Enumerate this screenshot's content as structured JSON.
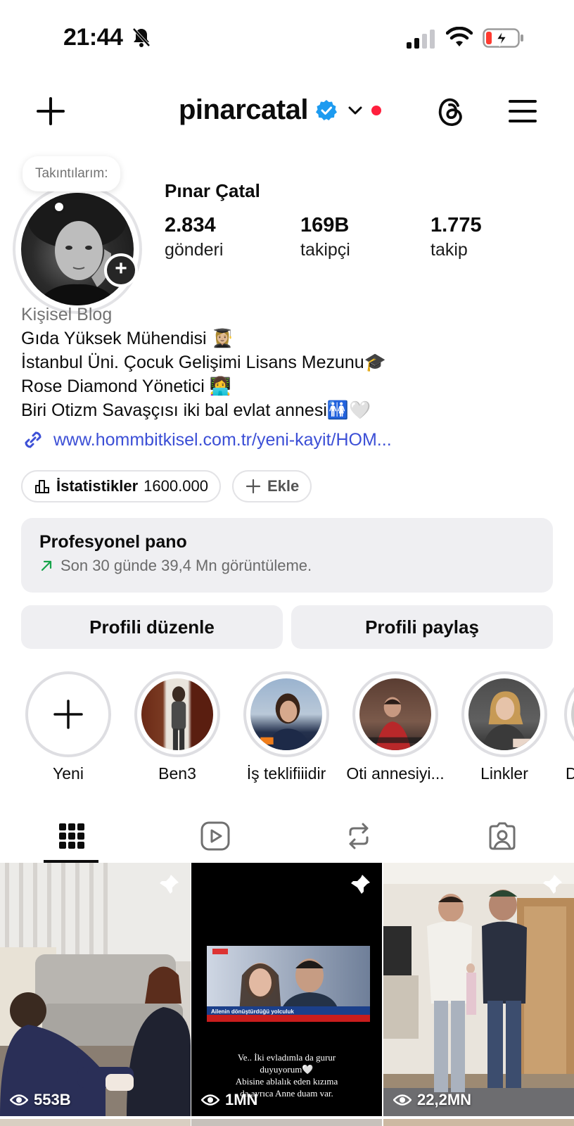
{
  "status_bar": {
    "time": "21:44"
  },
  "header": {
    "username": "pinarcatal"
  },
  "profile": {
    "note": "Takıntılarım:",
    "full_name": "Pınar Çatal",
    "stats": [
      {
        "value": "2.834",
        "label": "gönderi"
      },
      {
        "value": "169B",
        "label": "takipçi"
      },
      {
        "value": "1.775",
        "label": "takip"
      }
    ],
    "category": "Kişisel Blog",
    "bio_lines": [
      "Gıda Yüksek Mühendisi 👩🏼‍🎓",
      "İstanbul Üni. Çocuk Gelişimi Lisans Mezunu🎓",
      "Rose Diamond Yönetici 👩‍💻",
      "Biri Otizm Savaşçısı iki bal evlat annesi🚻🤍"
    ],
    "link": "www.hommbitkisel.com.tr/yeni-kayit/HOM..."
  },
  "pills": {
    "stats_label": "İstatistikler",
    "stats_value": "1600.000",
    "add_label": "Ekle"
  },
  "pro_panel": {
    "title": "Profesyonel pano",
    "subtitle": "Son 30 günde 39,4 Mn görüntüleme."
  },
  "buttons": {
    "edit": "Profili düzenle",
    "share": "Profili paylaş"
  },
  "highlights": [
    {
      "label": "Yeni"
    },
    {
      "label": "Ben3"
    },
    {
      "label": "İş teklifiiidir"
    },
    {
      "label": "Oti annesiyi..."
    },
    {
      "label": "Linkler"
    },
    {
      "label": "D"
    }
  ],
  "tabs": [
    "grid-icon",
    "reels-icon",
    "reposts-icon",
    "tagged-icon"
  ],
  "posts": [
    {
      "views": "553B",
      "pinned": true
    },
    {
      "views": "1MN",
      "pinned": true,
      "overlay_banner": "Ailenin dönüştürdüğü yolculuk",
      "caption_lines": [
        "Ve.. İki evladımla da gurur",
        "duyuyorum🤍",
        "Abisine ablalık eden kızıma",
        "da ayrıca Anne duam var."
      ]
    },
    {
      "views": "22,2MN",
      "pinned": true
    }
  ],
  "colors": {
    "verified": "#1d9bf0",
    "link": "#3c4fd6",
    "notification_dot": "#ff1f3d",
    "panel_bg": "#efeff2"
  }
}
